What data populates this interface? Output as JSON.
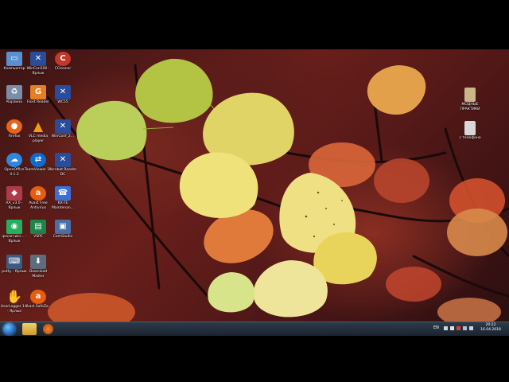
{
  "desktop": {
    "icons": [
      {
        "label": "Компьютер",
        "icon": "computer-icon",
        "color": "#5a8fd0"
      },
      {
        "label": "WinCon500 - Ярлык",
        "icon": "wincon-icon",
        "color": "#2a4c9a"
      },
      {
        "label": "CCleaner",
        "icon": "ccleaner-icon",
        "color": "#c0392b"
      },
      {
        "label": "Корзина",
        "icon": "recycle-bin-icon",
        "color": "#7a8ea8"
      },
      {
        "label": "Foxit Reader",
        "icon": "foxit-icon",
        "color": "#e67e22"
      },
      {
        "label": "WC55",
        "icon": "wc55-icon",
        "color": "#2a4c9a"
      },
      {
        "label": "Firefox",
        "icon": "firefox-icon",
        "color": "#e8641b"
      },
      {
        "label": "VLC media player",
        "icon": "vlc-icon",
        "color": "#f39c12"
      },
      {
        "label": "WinConf_2...",
        "icon": "winconf-icon",
        "color": "#2a4c9a"
      },
      {
        "label": "OpenOffice 4.1.2",
        "icon": "openoffice-icon",
        "color": "#2e86de"
      },
      {
        "label": "TeamViewer 12",
        "icon": "teamviewer-icon",
        "color": "#0e6bd1"
      },
      {
        "label": "Acrobat Reader DC",
        "icon": "acrobat-icon",
        "color": "#2a4c9a"
      },
      {
        "label": "AA_v3.0 - Ярлык",
        "icon": "aa-icon",
        "color": "#b03a48"
      },
      {
        "label": "Avast Free Antivirus",
        "icon": "avast-icon",
        "color": "#e85d0c"
      },
      {
        "label": "KX-TE Maintenan...",
        "icon": "kxte-icon",
        "color": "#3c6fd8"
      },
      {
        "label": "ipscan-win... - Ярлык",
        "icon": "ipscan-icon",
        "color": "#27ae60"
      },
      {
        "label": "VSPE",
        "icon": "vspe-icon",
        "color": "#1e8449"
      },
      {
        "label": "CamStudio",
        "icon": "camstudio-icon",
        "color": "#4a6fa5"
      },
      {
        "label": "putty - Ярлык",
        "icon": "putty-icon",
        "color": "#3d5a80"
      },
      {
        "label": "Download Master",
        "icon": "download-master-icon",
        "color": "#5d6d7e"
      },
      {
        "label": "UserLogger 1.7 - Ярлык",
        "icon": "userlogger-icon",
        "color": "#dfe6ee"
      },
      {
        "label": "Avast SafeZo...",
        "icon": "avast-safezone-icon",
        "color": "#e85d0c"
      }
    ],
    "right_icons": [
      {
        "label": "МОДНЫЕ ПРАКТИКИ",
        "icon": "folder-doc-icon",
        "color": "#c9b78a"
      },
      {
        "label": "с телефона",
        "icon": "folder-phone-icon",
        "color": "#d8d8d8"
      }
    ]
  },
  "taskbar": {
    "pinned": [
      {
        "icon": "start-orb-icon"
      },
      {
        "icon": "explorer-folder-icon",
        "color": "#e8c14a"
      },
      {
        "icon": "firefox-icon",
        "color": "#e8641b"
      }
    ],
    "tray": {
      "language": "EN",
      "time": "20:22",
      "date": "16.04.2018"
    }
  }
}
